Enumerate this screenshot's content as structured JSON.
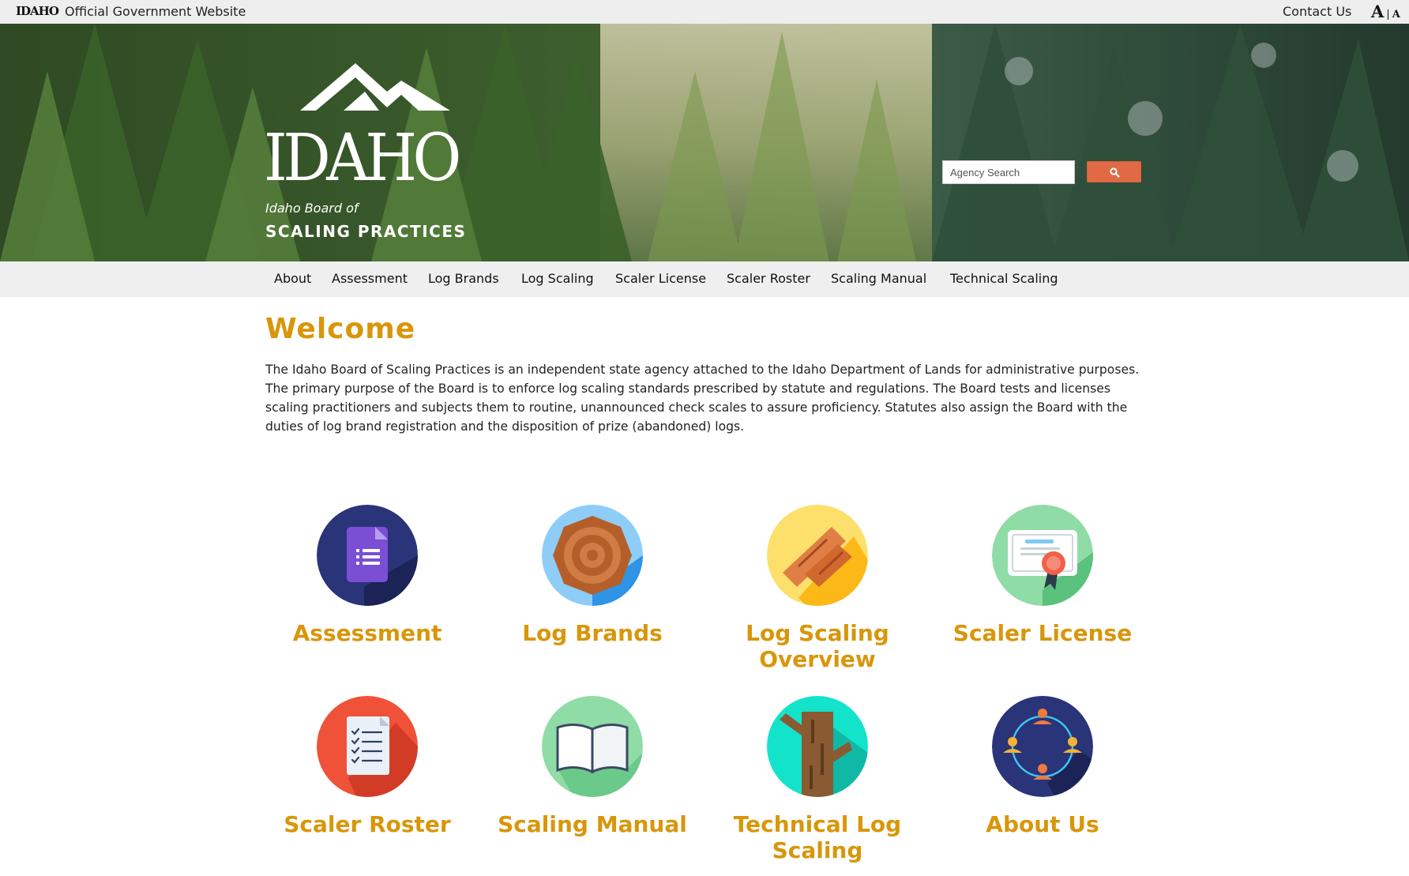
{
  "topbar": {
    "brand_mini": "IDAHO",
    "official_label": "Official Government Website",
    "contact_label": "Contact Us",
    "font_large": "A",
    "font_separator": "|",
    "font_small": "A"
  },
  "header": {
    "logo_wordmark": "IDAHO",
    "logo_subtitle": "Idaho Board of",
    "logo_title": "SCALING PRACTICES",
    "search_placeholder": "Agency Search",
    "search_icon": "magnifier-icon"
  },
  "nav": {
    "items": [
      {
        "label": "About"
      },
      {
        "label": "Assessment"
      },
      {
        "label": "Log Brands"
      },
      {
        "label": "Log Scaling"
      },
      {
        "label": "Scaler License"
      },
      {
        "label": "Scaler Roster"
      },
      {
        "label": "Scaling Manual"
      },
      {
        "label": "Technical Scaling"
      }
    ]
  },
  "main": {
    "heading": "Welcome",
    "intro": "The Idaho Board of Scaling Practices is an independent state agency attached to the Idaho Department of Lands for administrative purposes. The primary purpose of the Board is to enforce log scaling standards prescribed by statute and regulations. The Board tests and licenses scaling practitioners and subjects them to routine, unannounced check scales to assure proficiency. Statutes also assign the Board with the duties of log brand registration and the disposition of prize (abandoned) logs.",
    "tiles": [
      {
        "label": "Assessment",
        "icon": "document-list-icon",
        "color": "#2a3479"
      },
      {
        "label": "Log Brands",
        "icon": "log-end-rings-icon",
        "color": "#8ecdf7"
      },
      {
        "label": "Log Scaling Overview",
        "icon": "wood-planks-icon",
        "color": "#fde06c"
      },
      {
        "label": "Scaler License",
        "icon": "certificate-icon",
        "color": "#8fdca6"
      },
      {
        "label": "Scaler Roster",
        "icon": "checklist-icon",
        "color": "#ef5238"
      },
      {
        "label": "Scaling Manual",
        "icon": "open-book-icon",
        "color": "#8fdca6"
      },
      {
        "label": "Technical Log Scaling",
        "icon": "tree-trunk-icon",
        "color": "#14e3cc"
      },
      {
        "label": "About Us",
        "icon": "people-network-icon",
        "color": "#2a3479"
      }
    ]
  },
  "colors": {
    "accent_gold": "#d8960a",
    "search_button": "#e16a45",
    "nav_background": "#efefef"
  }
}
